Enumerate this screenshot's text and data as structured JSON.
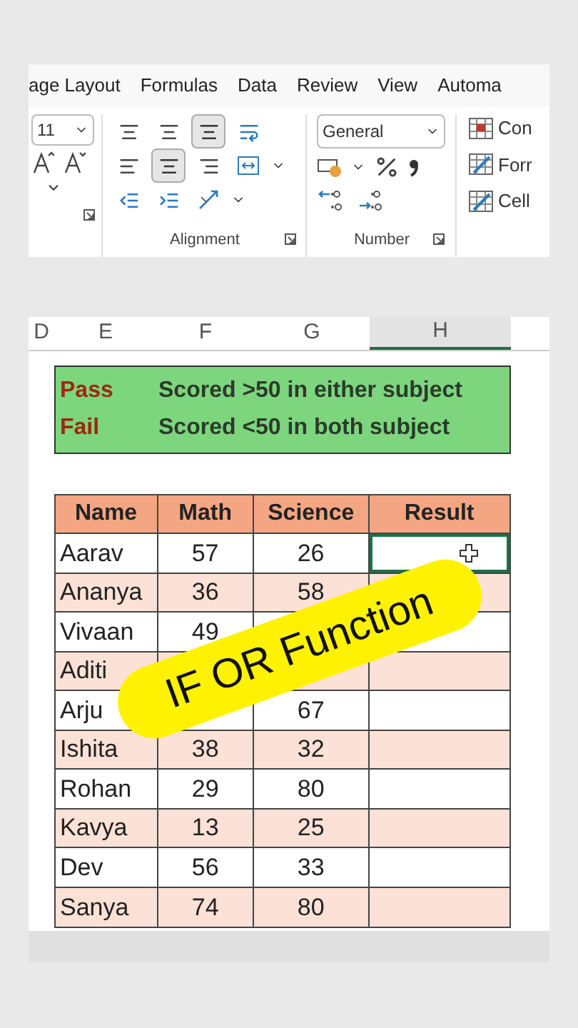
{
  "ribbon": {
    "tabs": [
      "age Layout",
      "Formulas",
      "Data",
      "Review",
      "View",
      "Automa"
    ],
    "font_size": "11",
    "alignment_label": "Alignment",
    "number_format": "General",
    "number_label": "Number",
    "styles": [
      "Con",
      "Forr",
      "Cell"
    ]
  },
  "sheet": {
    "columns": [
      {
        "label": "D",
        "selected": false
      },
      {
        "label": "E",
        "selected": false
      },
      {
        "label": "F",
        "selected": false
      },
      {
        "label": "G",
        "selected": false
      },
      {
        "label": "H",
        "selected": true
      }
    ],
    "legend": [
      {
        "status": "Pass",
        "description": "Scored >50 in either subject"
      },
      {
        "status": "Fail",
        "description": "Scored <50 in both subject"
      }
    ],
    "table": {
      "columns": [
        "Name",
        "Math",
        "Science",
        "Result"
      ],
      "rows": [
        {
          "name": "Aarav",
          "math": "57",
          "science": "26",
          "selected": true
        },
        {
          "name": "Ananya",
          "math": "36",
          "science": "58",
          "selected": false
        },
        {
          "name": "Vivaan",
          "math": "49",
          "selected": false
        },
        {
          "name": "Aditi",
          "selected": false
        },
        {
          "name": "Arju",
          "science": "67",
          "selected": false
        },
        {
          "name": "Ishita",
          "math": "38",
          "science": "32",
          "selected": false
        },
        {
          "name": "Rohan",
          "math": "29",
          "science": "80",
          "selected": false
        },
        {
          "name": "Kavya",
          "math": "13",
          "science": "25",
          "selected": false
        },
        {
          "name": "Dev",
          "math": "56",
          "science": "33",
          "selected": false
        },
        {
          "name": "Sanya",
          "math": "74",
          "science": "80",
          "selected": false
        }
      ]
    }
  },
  "overlay": {
    "text": "IF OR Function"
  }
}
